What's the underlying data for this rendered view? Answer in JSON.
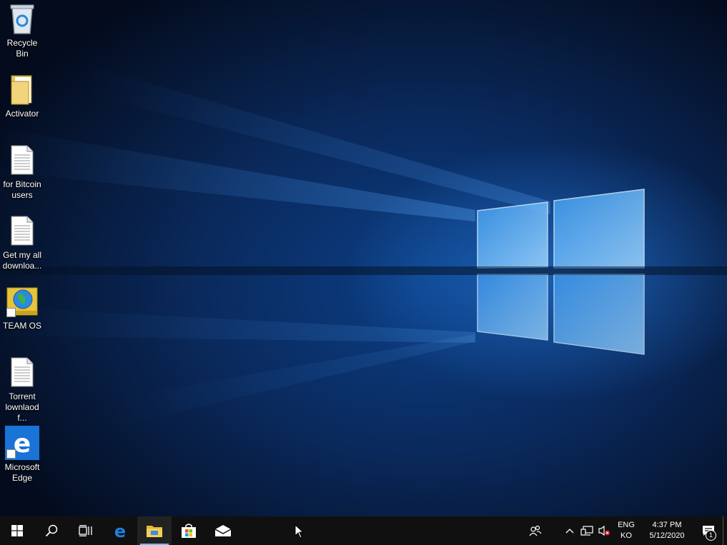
{
  "desktop": {
    "icons": [
      {
        "label": "Recycle Bin",
        "icon": "recycle-bin-icon"
      },
      {
        "label": "Activator",
        "icon": "folder-icon"
      },
      {
        "label": "for Bitcoin\nusers",
        "icon": "text-document-icon"
      },
      {
        "label": "Get my all\ndownloa...",
        "icon": "text-document-icon"
      },
      {
        "label": "TEAM OS",
        "icon": "globe-shortcut-icon"
      },
      {
        "label": "Torrent\nlownlaod f...",
        "icon": "text-document-icon"
      },
      {
        "label": "Microsoft\nEdge",
        "icon": "edge-icon"
      }
    ]
  },
  "taskbar": {
    "buttons": [
      "start-icon",
      "search-icon",
      "task-view-icon",
      "edge-icon",
      "file-explorer-icon",
      "store-icon",
      "mail-icon"
    ],
    "active": "file-explorer-icon",
    "tray": {
      "icons": [
        "people-icon",
        "show-hidden-icons-chevron",
        "network-icon",
        "volume-muted-icon"
      ],
      "language_top": "ENG",
      "language_bottom": "KO",
      "time": "4:37 PM",
      "date": "5/12/2020",
      "notification_count": "1"
    },
    "accent_color": "#76b9ed"
  }
}
